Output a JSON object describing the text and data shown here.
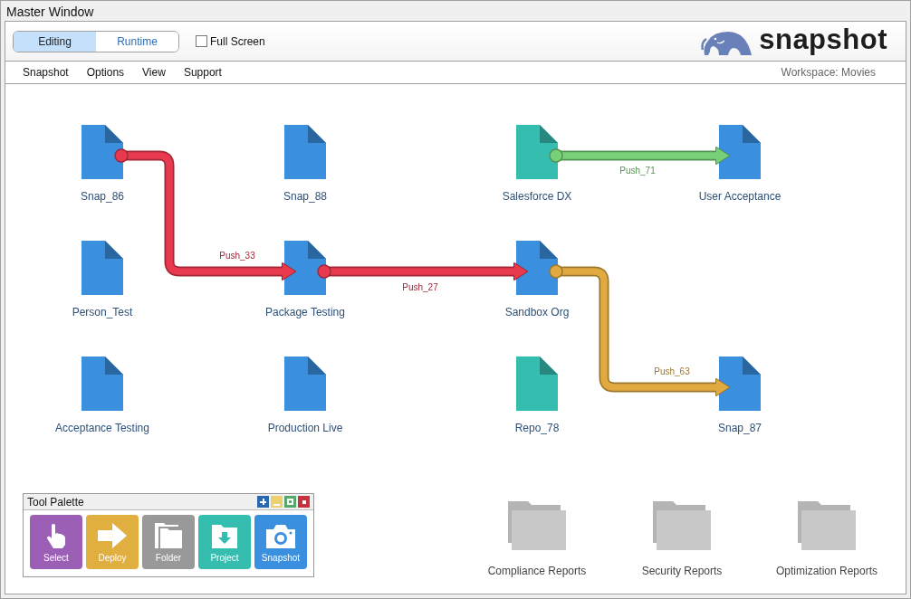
{
  "window": {
    "title": "Master Window"
  },
  "mode_tabs": [
    {
      "label": "Editing",
      "selected": true
    },
    {
      "label": "Runtime",
      "selected": false
    }
  ],
  "full_screen": {
    "label": "Full Screen",
    "checked": false
  },
  "logo": {
    "text": "snapshot"
  },
  "menu": [
    "Snapshot",
    "Options",
    "View",
    "Support"
  ],
  "workspace": "Workspace: Movies",
  "nodes": [
    {
      "label": "Snap_86",
      "color": "#3a8fde"
    },
    {
      "label": "Snap_88",
      "color": "#3a8fde"
    },
    {
      "label": "Salesforce DX",
      "color": "#35bdb0"
    },
    {
      "label": "User Acceptance",
      "color": "#3a8fde"
    },
    {
      "label": "Person_Test",
      "color": "#3a8fde"
    },
    {
      "label": "Package Testing",
      "color": "#3a8fde"
    },
    {
      "label": "Sandbox Org",
      "color": "#3a8fde"
    },
    {
      "label": "Acceptance Testing",
      "color": "#3a8fde"
    },
    {
      "label": "Production Live",
      "color": "#3a8fde"
    },
    {
      "label": "Repo_78",
      "color": "#35bdb0"
    },
    {
      "label": "Snap_87",
      "color": "#3a8fde"
    }
  ],
  "connections": [
    {
      "label": "Push_33",
      "color": "#e8394f"
    },
    {
      "label": "Push_27",
      "color": "#e8394f"
    },
    {
      "label": "Push_71",
      "color": "#78d078"
    },
    {
      "label": "Push_63",
      "color": "#e0aa40"
    }
  ],
  "folders": [
    "Compliance Reports",
    "Security Reports",
    "Optimization Reports"
  ],
  "tool_palette": {
    "title": "Tool Palette",
    "tools": [
      {
        "kind": "select",
        "label": "Select"
      },
      {
        "kind": "deploy",
        "label": "Deploy"
      },
      {
        "kind": "folder",
        "label": "Folder"
      },
      {
        "kind": "project",
        "label": "Project"
      },
      {
        "kind": "snapshot",
        "label": "Snapshot"
      }
    ]
  }
}
